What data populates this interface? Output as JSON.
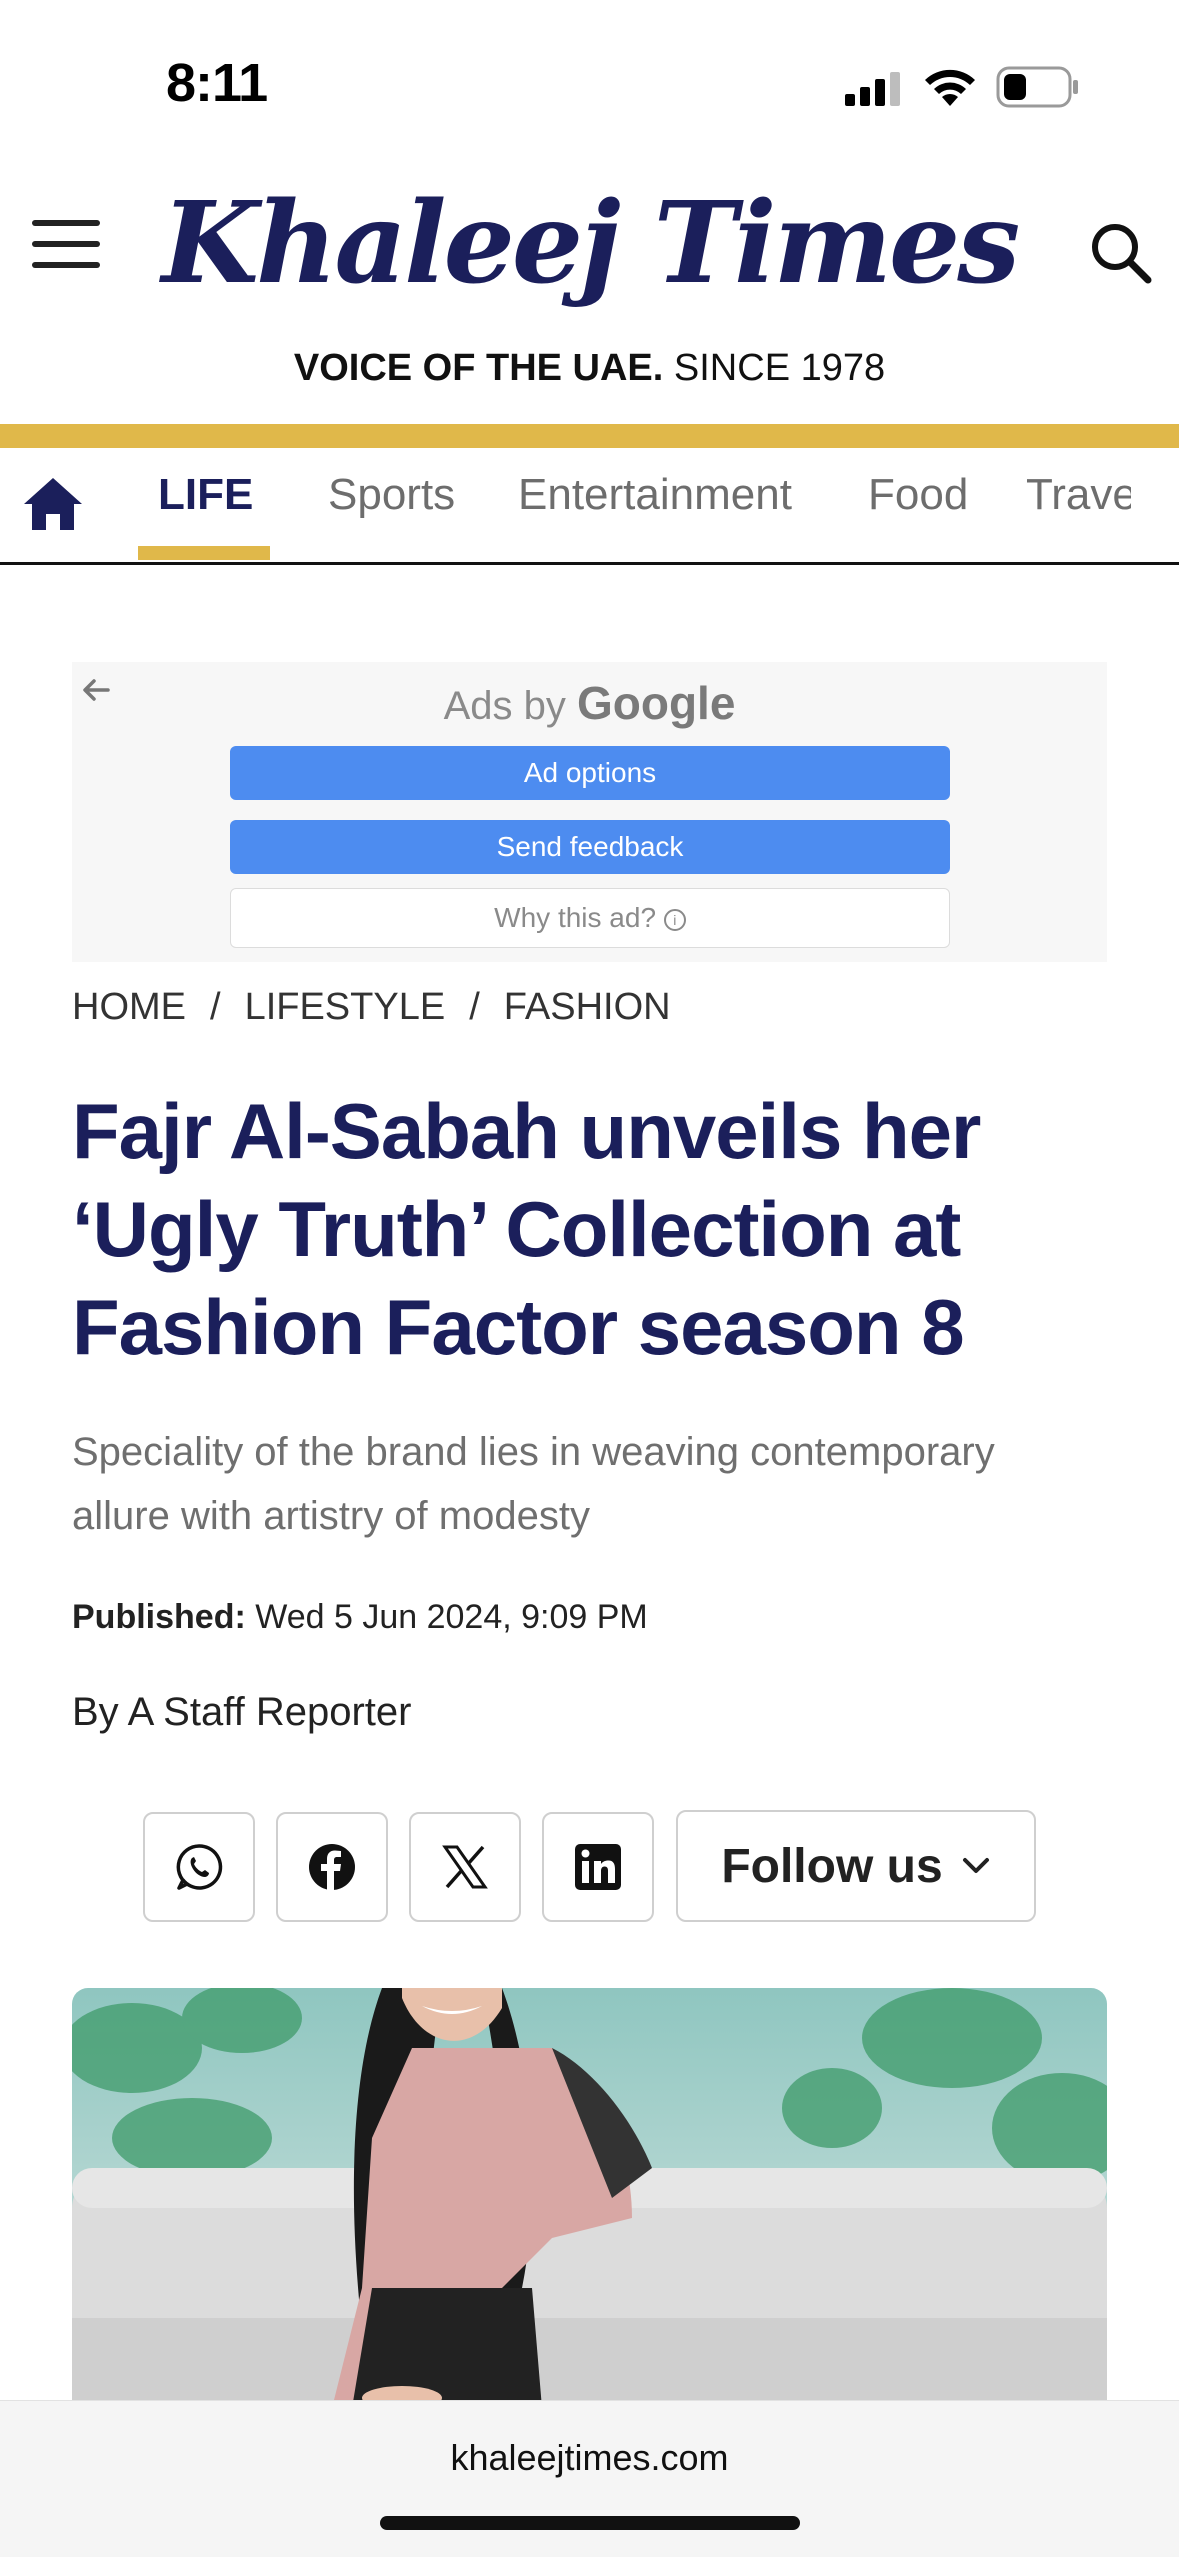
{
  "status_bar": {
    "time": "8:11"
  },
  "header": {
    "logo": "Khaleej Times",
    "tagline_bold": "VOICE OF THE UAE.",
    "tagline_rest": " SINCE 1978"
  },
  "nav": {
    "items": [
      "LIFE",
      "Sports",
      "Entertainment",
      "Food",
      "Trave"
    ],
    "active": "LIFE"
  },
  "ad": {
    "label_prefix": "Ads by ",
    "label_brand": "Google",
    "options_label": "Ad options",
    "feedback_label": "Send feedback",
    "why_label": "Why this ad?"
  },
  "breadcrumb": [
    "HOME",
    "LIFESTYLE",
    "FASHION"
  ],
  "article": {
    "headline": "Fajr Al-Sabah unveils her ‘Ugly Truth’ Collection at Fashion Factor season 8",
    "subhead": "Speciality of the brand lies in weaving contemporary allure with artistry of modesty",
    "published_label": "Published:",
    "published_value": " Wed 5 Jun 2024, 9:09 PM",
    "byline": "By A Staff Reporter"
  },
  "share": {
    "follow_label": "Follow us"
  },
  "browser": {
    "url": "khaleejtimes.com"
  },
  "colors": {
    "brand_navy": "#1b1f5b",
    "gold": "#e0b84a",
    "ad_blue": "#4d8cf0"
  }
}
